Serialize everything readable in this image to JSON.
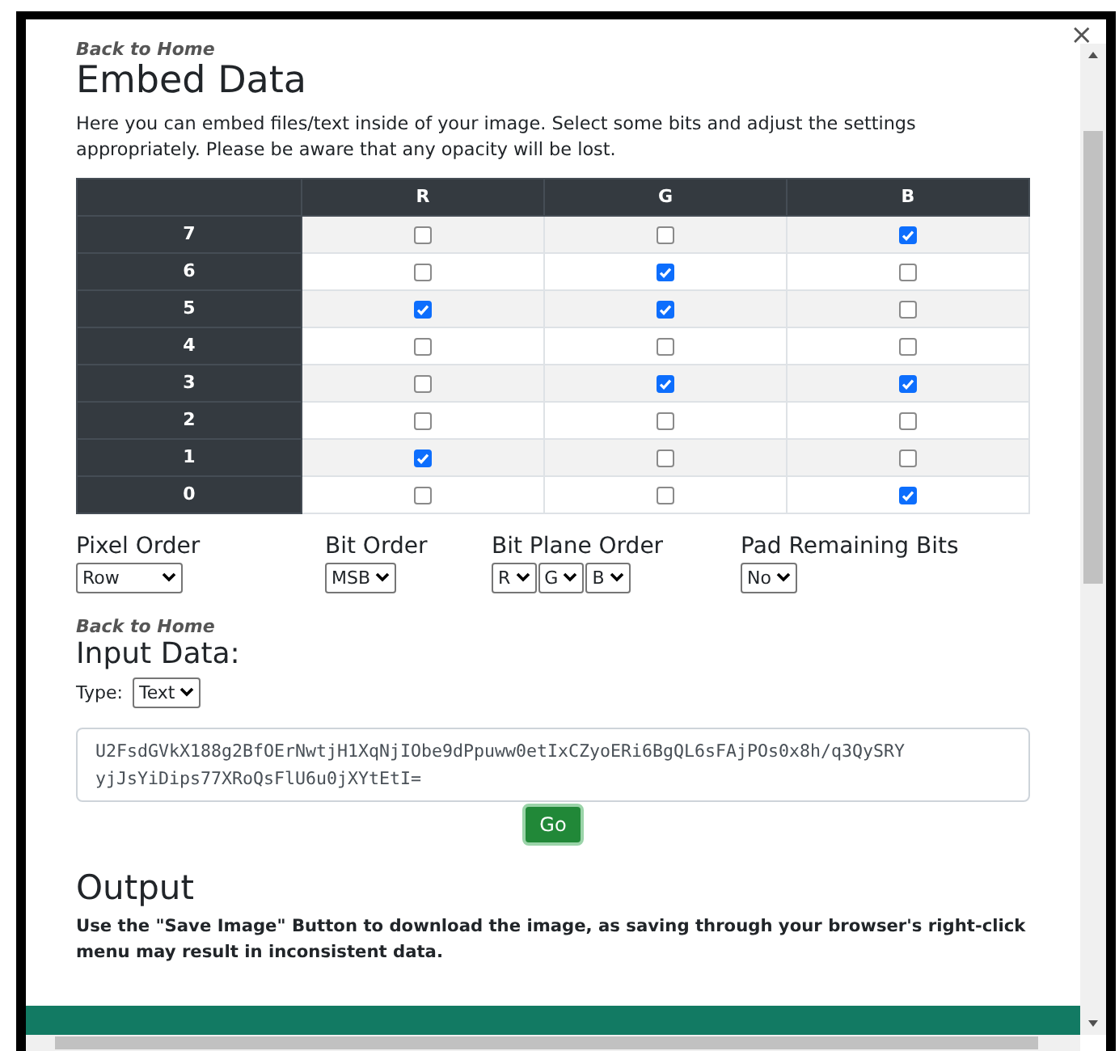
{
  "close": "×",
  "back_link": "Back to Home",
  "title": "Embed Data",
  "intro": "Here you can embed files/text inside of your image. Select some bits and adjust the settings appropriately. Please be aware that any opacity will be lost.",
  "bit_table": {
    "columns": [
      "R",
      "G",
      "B"
    ],
    "rows": [
      {
        "bit": "7",
        "cells": [
          {
            "checked": false
          },
          {
            "checked": false
          },
          {
            "checked": true
          }
        ]
      },
      {
        "bit": "6",
        "cells": [
          {
            "checked": false
          },
          {
            "checked": true
          },
          {
            "checked": false
          }
        ]
      },
      {
        "bit": "5",
        "cells": [
          {
            "checked": true
          },
          {
            "checked": true
          },
          {
            "checked": false
          }
        ]
      },
      {
        "bit": "4",
        "cells": [
          {
            "checked": false
          },
          {
            "checked": false
          },
          {
            "checked": false
          }
        ]
      },
      {
        "bit": "3",
        "cells": [
          {
            "checked": false
          },
          {
            "checked": true
          },
          {
            "checked": true
          }
        ]
      },
      {
        "bit": "2",
        "cells": [
          {
            "checked": false
          },
          {
            "checked": false
          },
          {
            "checked": false
          }
        ]
      },
      {
        "bit": "1",
        "cells": [
          {
            "checked": true
          },
          {
            "checked": false
          },
          {
            "checked": false
          }
        ]
      },
      {
        "bit": "0",
        "cells": [
          {
            "checked": false
          },
          {
            "checked": false
          },
          {
            "checked": true
          }
        ]
      }
    ]
  },
  "settings": [
    {
      "label": "Pixel Order",
      "selects": [
        "Row"
      ]
    },
    {
      "label": "Bit Order",
      "selects": [
        "MSB"
      ]
    },
    {
      "label": "Bit Plane Order",
      "selects": [
        "R",
        "G",
        "B"
      ]
    },
    {
      "label": "Pad Remaining Bits",
      "selects": [
        "No"
      ]
    }
  ],
  "input": {
    "back_link": "Back to Home",
    "title": "Input Data:",
    "type_label": "Type:",
    "type_value": "Text",
    "value": "U2FsdGVkX188g2BfOErNwtjH1XqNjIObe9dPpuww0etIxCZyoERi6BgQL6sFAjPOs0x8h/q3QySRYyjJsYiDips77XRoQsFlU6u0jXYtEtI=",
    "button": "Go"
  },
  "output": {
    "title": "Output",
    "note": "Use the \"Save Image\" Button to download the image, as saving through your browser's right-click menu may result in inconsistent data."
  }
}
